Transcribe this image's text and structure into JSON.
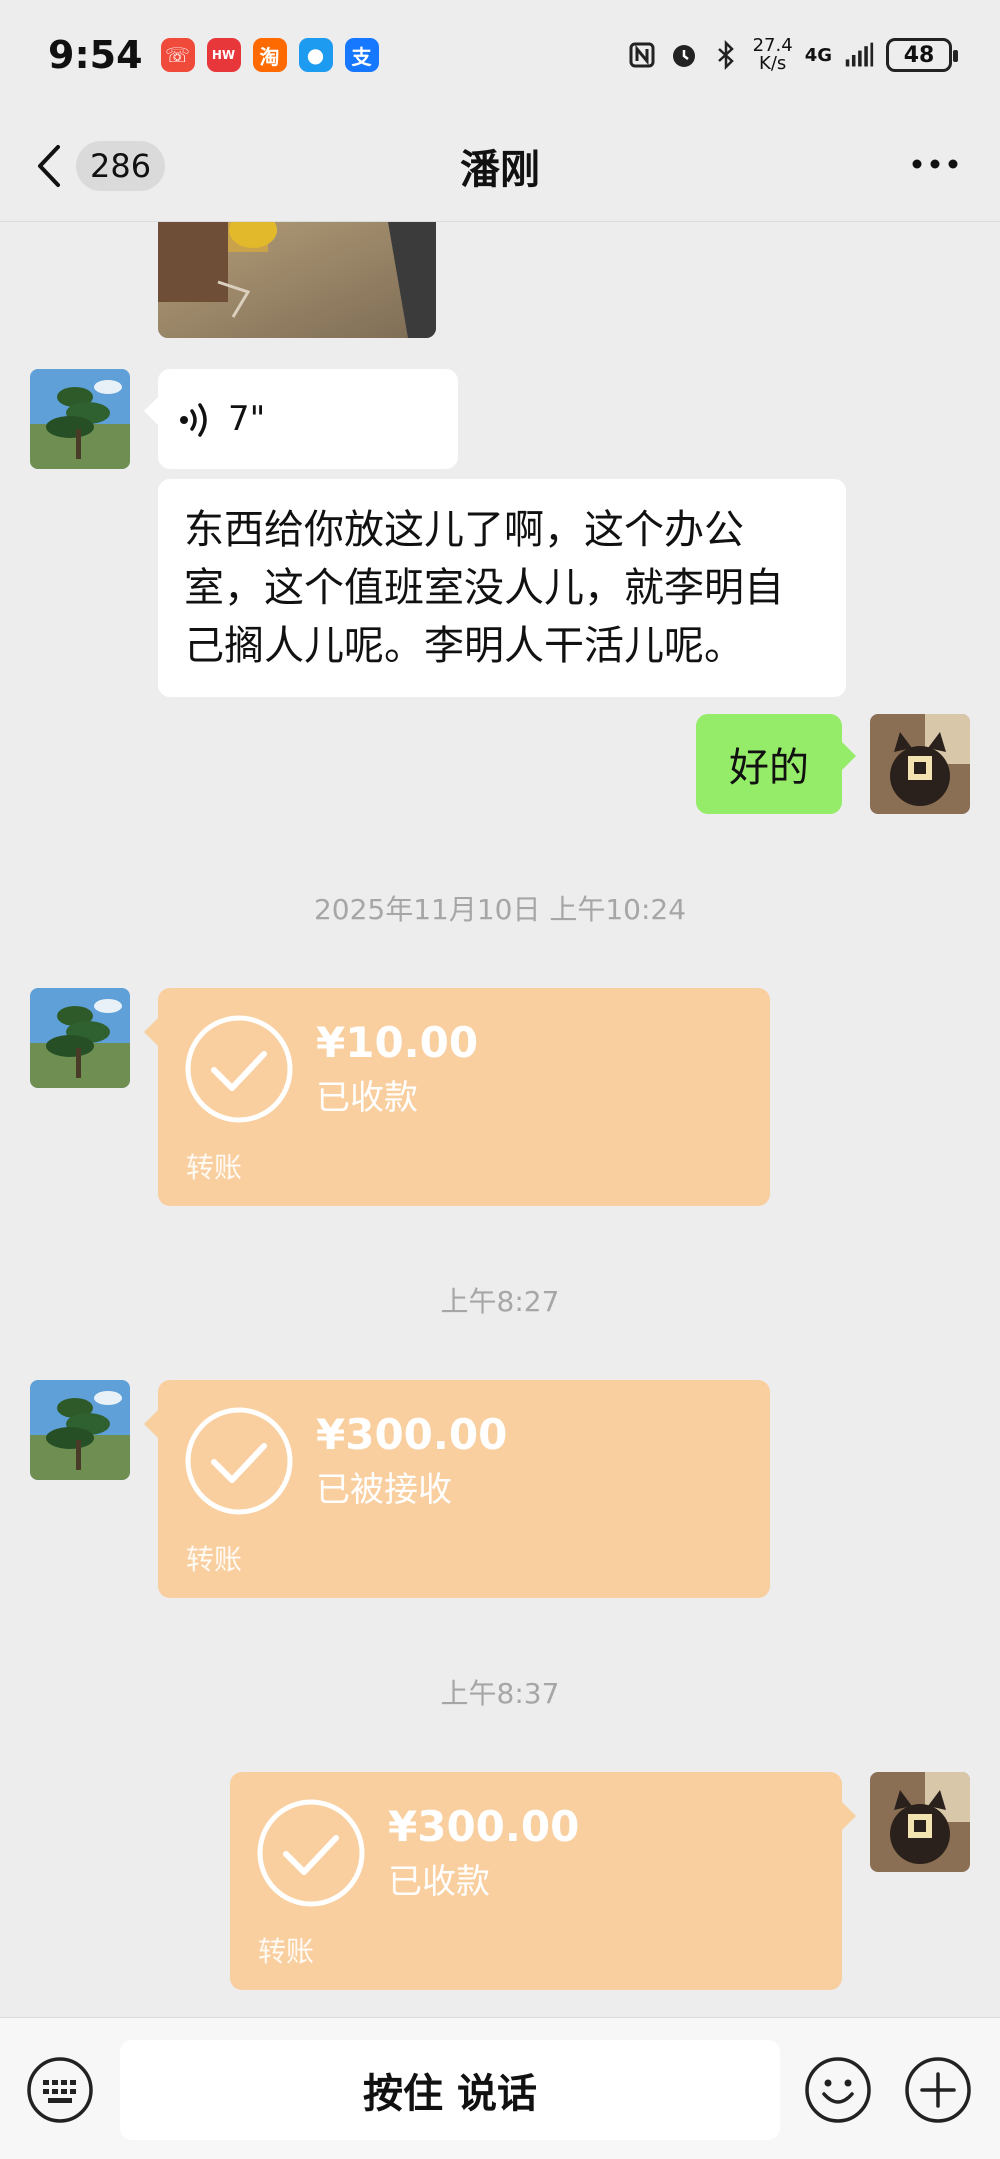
{
  "status_bar": {
    "time": "9:54",
    "app_icons": [
      {
        "name": "phone-app-icon",
        "glyph": "☏",
        "color": "#f04a3a"
      },
      {
        "name": "huawei-app-icon",
        "glyph": "HW",
        "color": "#e8373b"
      },
      {
        "name": "taobao-app-icon",
        "glyph": "淘",
        "color": "#ff6a00"
      },
      {
        "name": "message-app-icon",
        "glyph": "●",
        "color": "#1d9bf0"
      },
      {
        "name": "alipay-app-icon",
        "glyph": "支",
        "color": "#1677ff"
      }
    ],
    "network_speed_value": "27.4",
    "network_speed_unit": "K/s",
    "network_type": "4G",
    "battery": "48"
  },
  "header": {
    "back_count": "286",
    "title": "潘刚"
  },
  "messages": {
    "voice_duration": "7\"",
    "incoming_text": "东西给你放这儿了啊，这个办公室，这个值班室没人儿，就李明自己搁人儿呢。李明人干活儿呢。",
    "outgoing_text": "好的",
    "timestamp_1": "2025年11月10日 上午10:24",
    "transfer_1": {
      "amount": "¥10.00",
      "status": "已收款",
      "label": "转账"
    },
    "timestamp_2": "上午8:27",
    "transfer_2": {
      "amount": "¥300.00",
      "status": "已被接收",
      "label": "转账"
    },
    "timestamp_3": "上午8:37",
    "transfer_3": {
      "amount": "¥300.00",
      "status": "已收款",
      "label": "转账"
    }
  },
  "input_bar": {
    "hold_to_talk": "按住 说话"
  },
  "colors": {
    "background": "#ededed",
    "outgoing_bubble": "#95ec69",
    "transfer_card": "#f9cfa0"
  }
}
